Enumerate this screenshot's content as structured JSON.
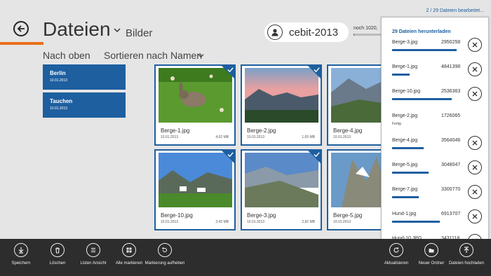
{
  "header": {
    "title": "Dateien",
    "subtitle": "Bilder",
    "nav_up": "Nach oben",
    "sort_label": "Sortieren nach Namen"
  },
  "account": {
    "name": "cebit-2013",
    "quota_text": "noch 1020,",
    "quota_fraction": 0.02
  },
  "folders": [
    {
      "name": "Berlin",
      "date": "10.01.2013"
    },
    {
      "name": "Tauchen",
      "date": "10.01.2013"
    }
  ],
  "files": [
    {
      "name": "Berge-1.jpg",
      "date": "10.01.2013",
      "size": "4,62 MB",
      "selected": true
    },
    {
      "name": "Berge-2.jpg",
      "date": "10.01.2013",
      "size": "1,65 MB",
      "selected": true
    },
    {
      "name": "Berge-4.jpg",
      "date": "10.01.2013",
      "size": "",
      "selected": true
    },
    {
      "name": "Berge-10.jpg",
      "date": "10.01.2013",
      "size": "2,42 MB",
      "selected": true
    },
    {
      "name": "Berge-3.jpg",
      "date": "10.01.2013",
      "size": "2,82 MB",
      "selected": true
    },
    {
      "name": "Berge-5.jpg",
      "date": "10.01.2013",
      "size": "",
      "selected": true
    }
  ],
  "downloads": {
    "status": "2 / 29 Dateien bearbeitet...",
    "title": "29 Dateien herunterladen",
    "items": [
      {
        "name": "Berge-3.jpg",
        "size": "2950258",
        "progress": 0.92,
        "done_text": ""
      },
      {
        "name": "Berge-1.jpg",
        "size": "4841398",
        "progress": 0.25,
        "done_text": ""
      },
      {
        "name": "Berge-10.jpg",
        "size": "2536363",
        "progress": 0.85,
        "done_text": ""
      },
      {
        "name": "Berge-2.jpg",
        "size": "1726065",
        "progress": 1.0,
        "done_text": "Fertig"
      },
      {
        "name": "Berge-4.jpg",
        "size": "3564046",
        "progress": 0.45,
        "done_text": ""
      },
      {
        "name": "Berge-5.jpg",
        "size": "3048047",
        "progress": 0.52,
        "done_text": ""
      },
      {
        "name": "Berge-7.jpg",
        "size": "3300770",
        "progress": 0.38,
        "done_text": ""
      },
      {
        "name": "Hund-1.jpg",
        "size": "6913707",
        "progress": 0.68,
        "done_text": ""
      },
      {
        "name": "Hund-10.JPG",
        "size": "3431118",
        "progress": 0.1,
        "done_text": ""
      }
    ]
  },
  "appbar": {
    "left": [
      {
        "label": "Speichern",
        "icon": "download-icon"
      },
      {
        "label": "Löschen",
        "icon": "trash-icon"
      },
      {
        "label": "Listen Ansicht",
        "icon": "list-icon"
      },
      {
        "label": "Alle markieren",
        "icon": "select-all-icon"
      },
      {
        "label": "Markierung aufheben",
        "icon": "clear-selection-icon"
      }
    ],
    "right": [
      {
        "label": "Aktualisieren",
        "icon": "refresh-icon"
      },
      {
        "label": "Neuer Ordner",
        "icon": "new-folder-icon"
      },
      {
        "label": "Dateien hochladen",
        "icon": "upload-icon"
      }
    ]
  },
  "colors": {
    "accent": "#1e5fa0",
    "orange": "#e8701a",
    "appbar": "#2d2d2d",
    "background": "#e5e5e5"
  }
}
